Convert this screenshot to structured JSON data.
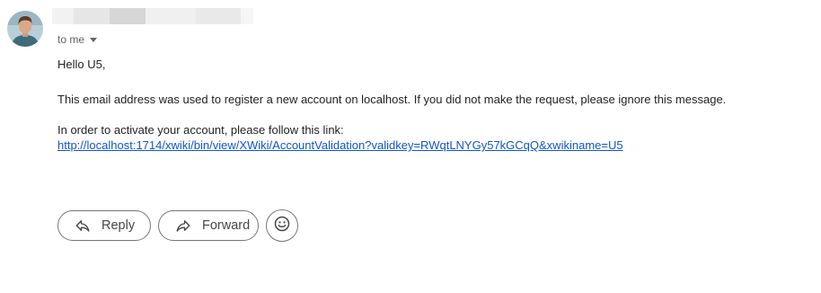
{
  "message": {
    "recipient_label": "to me",
    "greeting": "Hello U5,",
    "paragraph_1": "This email address was used to register a new account on localhost. If you did not make the request, please ignore this message.",
    "paragraph_2": "In order to activate your account, please follow this link:",
    "activation_link": "http://localhost:1714/xwiki/bin/view/XWiki/AccountValidation?validkey=RWqtLNYGy57kGCqQ&xwikiname=U5"
  },
  "actions": {
    "reply_label": "Reply",
    "forward_label": "Forward",
    "reply_icon": "reply-icon",
    "forward_icon": "forward-icon",
    "emoji_icon": "emoji-reaction-icon"
  },
  "colors": {
    "link": "#1155cc",
    "text": "#222222",
    "muted": "#5f6368",
    "button_border": "#747775"
  }
}
